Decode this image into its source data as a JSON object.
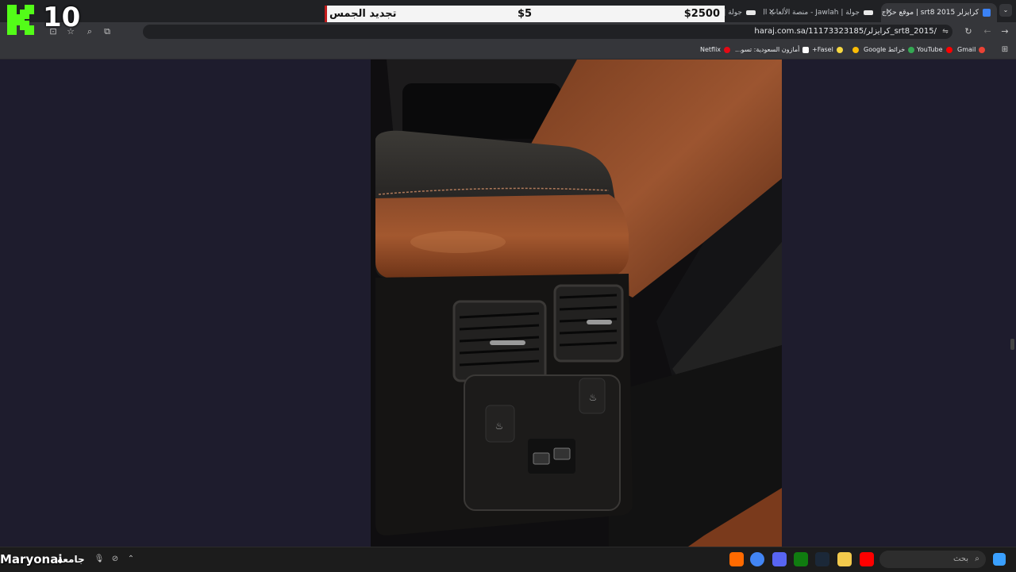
{
  "overlay": {
    "timer": "10",
    "price_bar": {
      "left_price": "$2500",
      "mid_price": "$5",
      "right_label": "تجديد الجمس"
    }
  },
  "tabs": [
    {
      "title": "كرايزلر srt8 2015 | موقع حراج",
      "active": true,
      "fav_color": "#3b82f6"
    },
    {
      "title": "جولة | Jawlah - منصة الألعاب ال...",
      "active": false,
      "fav_color": "#e8e8e8"
    },
    {
      "title": "جولة |",
      "active": false,
      "fav_color": "#e8e8e8"
    }
  ],
  "toolbar": {
    "url": "haraj.com.sa/11173323185/كرايزلر_srt8_2015/"
  },
  "bookmarks": [
    {
      "label": "Gmail",
      "color": "#ea4335"
    },
    {
      "label": "YouTube",
      "color": "#ff0000"
    },
    {
      "label": "خرائط Google",
      "color": "#34a853"
    },
    {
      "label": "",
      "color": "#fbbc05"
    },
    {
      "label": "Fasel+",
      "color": "#f5d742"
    },
    {
      "label": "أمازون السعودية: تسو...",
      "color": "#ffffff"
    },
    {
      "label": "Netflix",
      "color": "#e50914"
    }
  ],
  "taskbar": {
    "streamer": "Maryonai",
    "tray_label": "جامعه",
    "search_placeholder": "بحث",
    "apps_colors": [
      "#ff6a00",
      "#4285f4",
      "#5865f2",
      "#e34d6a",
      "#107c10",
      "#1b2838",
      "#f2c94c",
      "#ff0000"
    ]
  }
}
